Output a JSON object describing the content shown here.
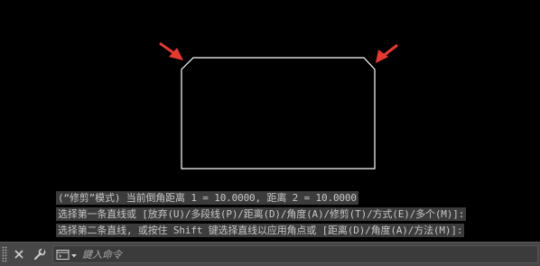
{
  "colors": {
    "canvas": "#000000",
    "shape_stroke": "#ffffff",
    "arrow": "#e8392f",
    "history_bg": "#3c3c3c",
    "history_text": "#c8c8c8",
    "cmdbar_bg": "#474747"
  },
  "history": {
    "lines": [
      "(“修剪”模式) 当前倒角距离 1 = 10.0000, 距离 2 = 10.0000",
      "选择第一条直线或 [放弃(U)/多段线(P)/距离(D)/角度(A)/修剪(T)/方式(E)/多个(M)]:",
      "选择第二条直线, 或按住 Shift 键选择直线以应用角点或 [距离(D)/角度(A)/方法(M)]:"
    ]
  },
  "command_bar": {
    "close_icon": "close-icon",
    "customize_icon": "wrench-icon",
    "prompt_icon": "command-prompt-icon",
    "placeholder": "鍵入命令"
  }
}
